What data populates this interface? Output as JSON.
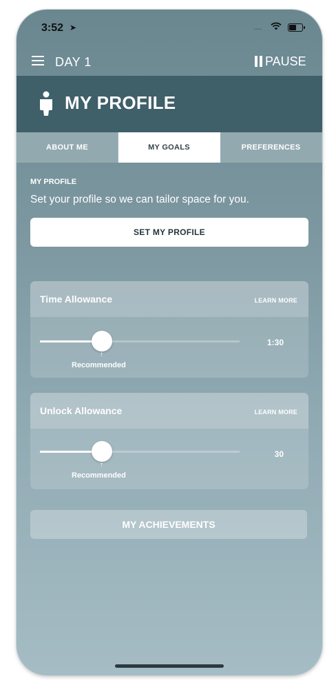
{
  "status_bar": {
    "time": "3:52",
    "location_icon": "location-arrow-icon",
    "signal": "....",
    "wifi_icon": "wifi-icon",
    "battery_icon": "battery-icon"
  },
  "nav": {
    "day_label": "DAY 1",
    "pause_label": "PAUSE",
    "menu_icon": "hamburger-icon",
    "pause_icon": "pause-icon"
  },
  "header": {
    "title": "MY PROFILE",
    "icon": "person-icon"
  },
  "tabs": [
    {
      "label": "ABOUT ME",
      "active": false
    },
    {
      "label": "MY GOALS",
      "active": true
    },
    {
      "label": "PREFERENCES",
      "active": false
    }
  ],
  "profile": {
    "section_label": "MY PROFILE",
    "description": "Set your profile so we can tailor space for you.",
    "button_label": "SET MY PROFILE"
  },
  "time_allowance": {
    "title": "Time Allowance",
    "learn_more": "LEARN MORE",
    "value": "1:30",
    "recommended_label": "Recommended",
    "slider_fraction": 0.31
  },
  "unlock_allowance": {
    "title": "Unlock Allowance",
    "learn_more": "LEARN MORE",
    "value": "30",
    "recommended_label": "Recommended",
    "slider_fraction": 0.31
  },
  "achievements": {
    "button_label": "MY ACHIEVEMENTS"
  },
  "colors": {
    "header": "#3f5f69",
    "active_tab": "#ffffff",
    "background_top": "#6a8790",
    "background_bottom": "#a5bcc4"
  }
}
